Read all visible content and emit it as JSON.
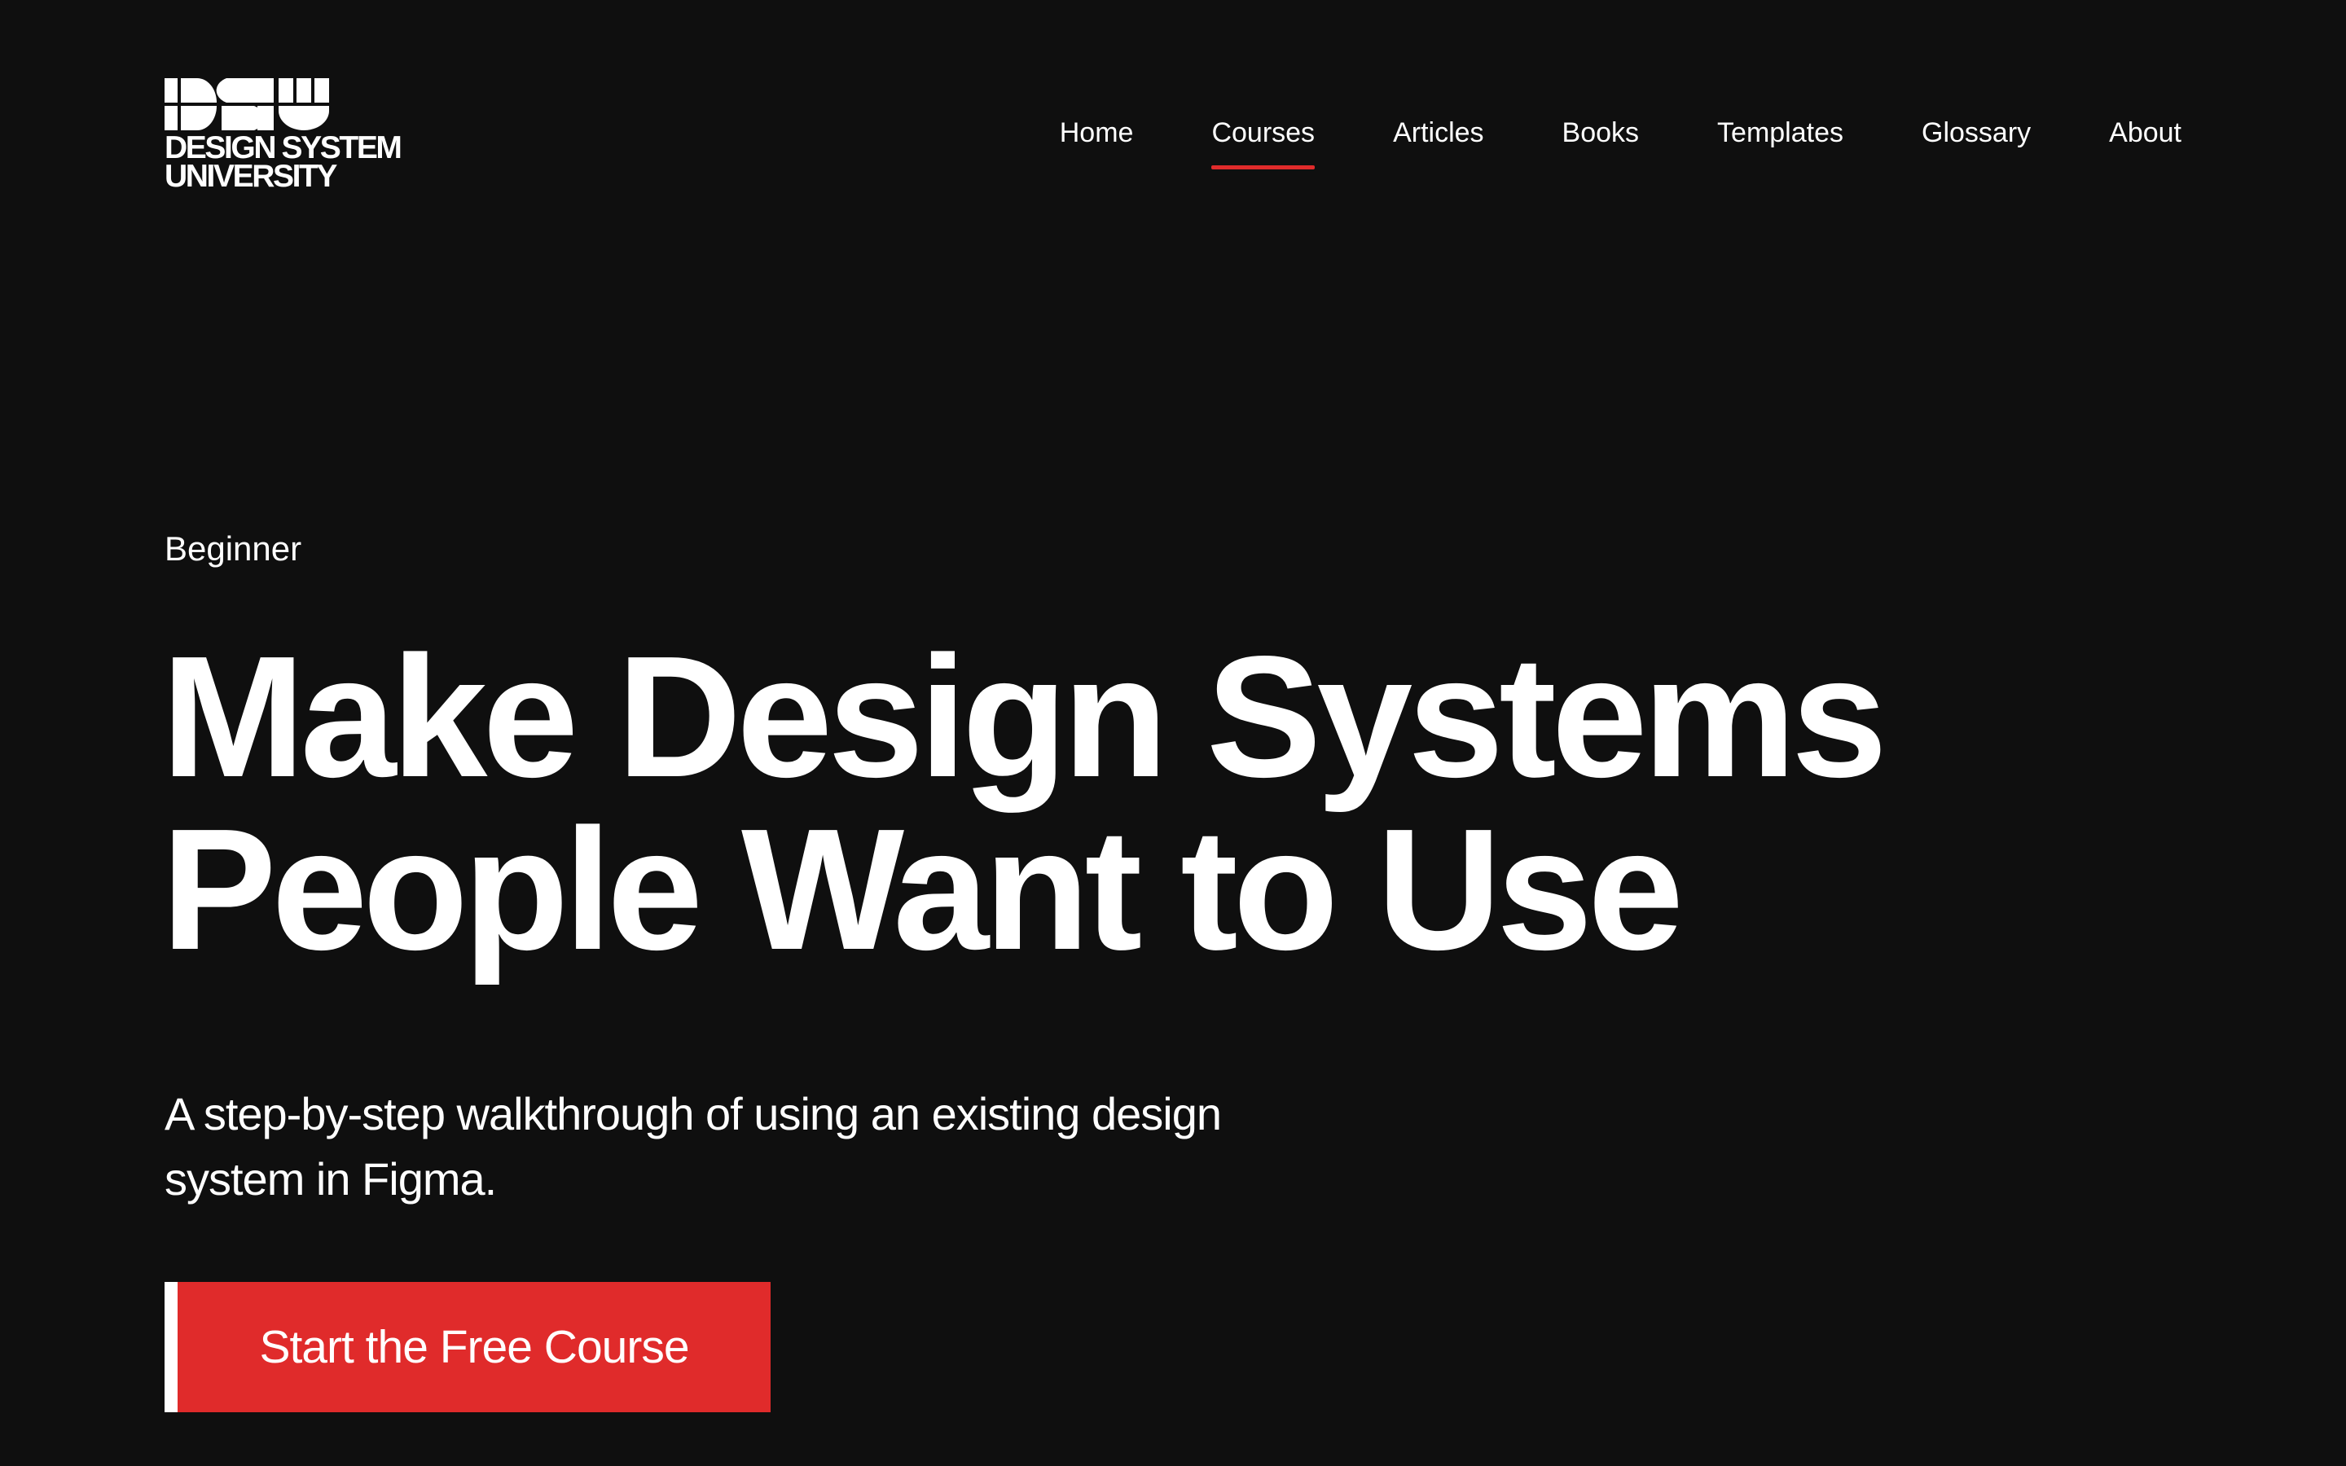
{
  "brand": {
    "logo_line1": "DESIGN SYSTEM",
    "logo_line2": "UNIVERSITY",
    "logo_mark_icon": "dsu-monogram-icon"
  },
  "nav": {
    "items": [
      {
        "label": "Home",
        "active": false
      },
      {
        "label": "Courses",
        "active": true
      },
      {
        "label": "Articles",
        "active": false
      },
      {
        "label": "Books",
        "active": false
      },
      {
        "label": "Templates",
        "active": false
      },
      {
        "label": "Glossary",
        "active": false
      },
      {
        "label": "About",
        "active": false
      }
    ]
  },
  "hero": {
    "level": "Beginner",
    "headline_line1": "Make Design Systems",
    "headline_line2": "People Want to Use",
    "subtitle": "A step-by-step walkthrough of using an existing design system in Figma.",
    "cta_label": "Start the Free Course"
  },
  "colors": {
    "background": "#0f0f0f",
    "text": "#ffffff",
    "accent": "#e02b2b"
  }
}
